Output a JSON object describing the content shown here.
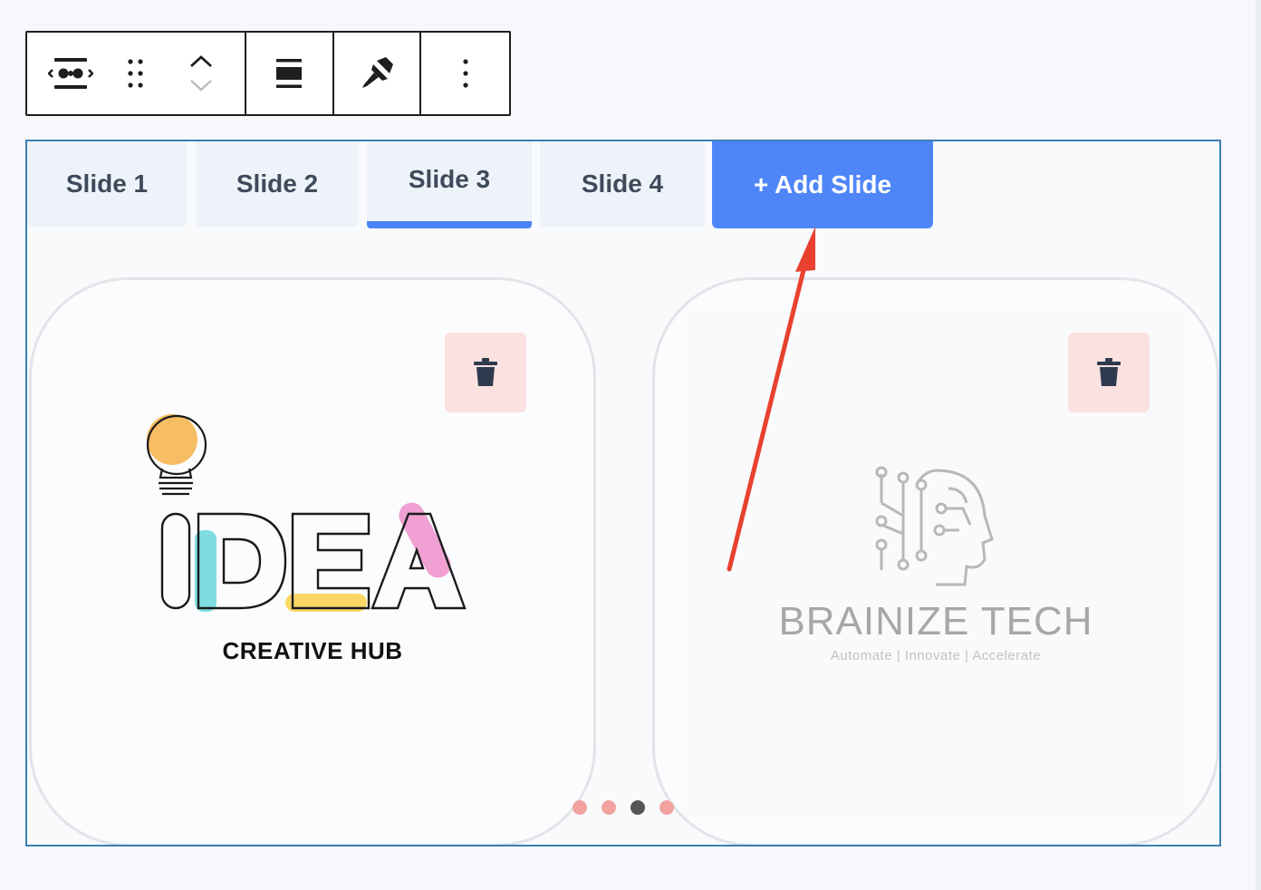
{
  "toolbar": {
    "icons": [
      "slider-block-icon",
      "drag-handle-icon",
      "move-up-icon",
      "move-down-icon",
      "align-icon",
      "brush-icon",
      "more-options-icon"
    ]
  },
  "tabs": [
    {
      "label": "Slide 1",
      "active": false
    },
    {
      "label": "Slide 2",
      "active": false
    },
    {
      "label": "Slide 3",
      "active": true
    },
    {
      "label": "Slide 4",
      "active": false
    }
  ],
  "add_slide_label": "+ Add Slide",
  "slides": [
    {
      "logo_word": "IDEA",
      "caption": "CREATIVE HUB"
    },
    {
      "title": "BRAINIZE TECH",
      "tagline": "Automate | Innovate | Accelerate"
    }
  ],
  "pagination": {
    "count": 4,
    "active_index": 2
  },
  "colors": {
    "accent": "#4f86f7",
    "frame": "#3d7fb0",
    "delete_bg": "#fbe1df",
    "dot": "#f2a3a0",
    "dot_active": "#555555",
    "annotation_arrow": "#e8412f"
  }
}
